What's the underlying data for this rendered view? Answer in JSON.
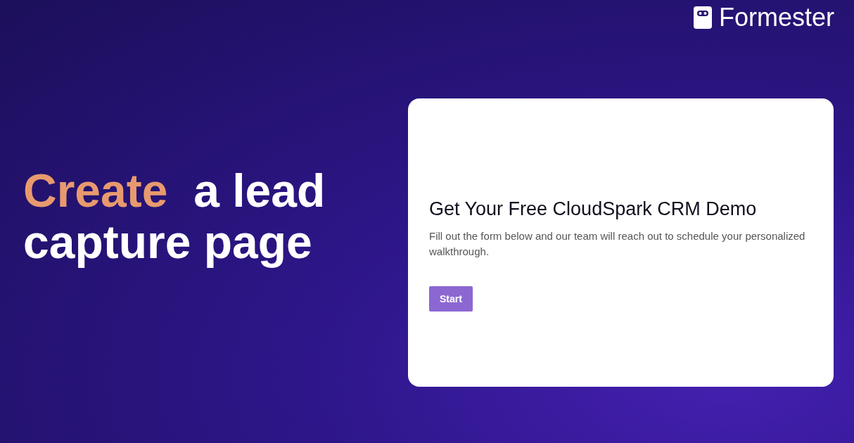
{
  "brand": {
    "name": "Formester"
  },
  "headline": {
    "highlight": "Create",
    "rest": "a lead capture page"
  },
  "form_card": {
    "title": "Get Your Free CloudSpark CRM Demo",
    "description": "Fill out the form below and our team will reach out to schedule your personalized walkthrough.",
    "button": "Start"
  }
}
